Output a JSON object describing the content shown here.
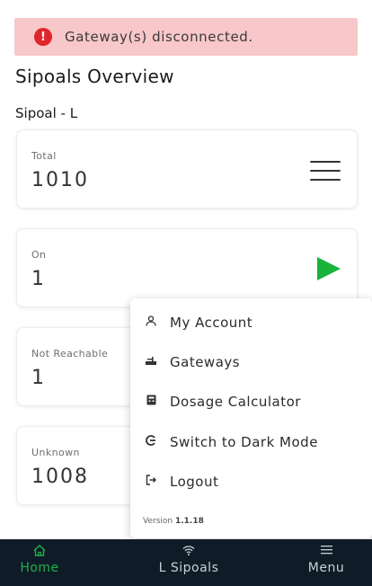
{
  "alert": {
    "icon": "exclamation-icon",
    "text": "Gateway(s) disconnected."
  },
  "header": {
    "title": "Sipoals Overview",
    "group": "Sipoal - L"
  },
  "cards": [
    {
      "label": "Total",
      "value": "1010",
      "icon": "hamburger-icon"
    },
    {
      "label": "On",
      "value": "1",
      "icon": "play-icon"
    },
    {
      "label": "Not Reachable",
      "value": "1"
    },
    {
      "label": "Unknown",
      "value": "1008"
    }
  ],
  "menu": {
    "items": [
      {
        "icon": "user-icon",
        "label": "My Account"
      },
      {
        "icon": "gateway-icon",
        "label": "Gateways"
      },
      {
        "icon": "calculator-icon",
        "label": "Dosage Calculator"
      },
      {
        "icon": "theme-icon",
        "label": "Switch to Dark Mode"
      },
      {
        "icon": "logout-icon",
        "label": "Logout"
      }
    ],
    "version_label": "Version",
    "version_number": "1.1.18"
  },
  "nav": {
    "items": [
      {
        "icon": "home-icon",
        "label": "Home"
      },
      {
        "icon": "wifi-icon",
        "label": "L Sipoals"
      },
      {
        "icon": "menu-icon",
        "label": "Menu"
      }
    ]
  },
  "colors": {
    "alert_bg": "#f7c7c9",
    "alert_icon": "#e0262c",
    "accent_green": "#18b33a",
    "nav_bg": "#0f1c28"
  }
}
